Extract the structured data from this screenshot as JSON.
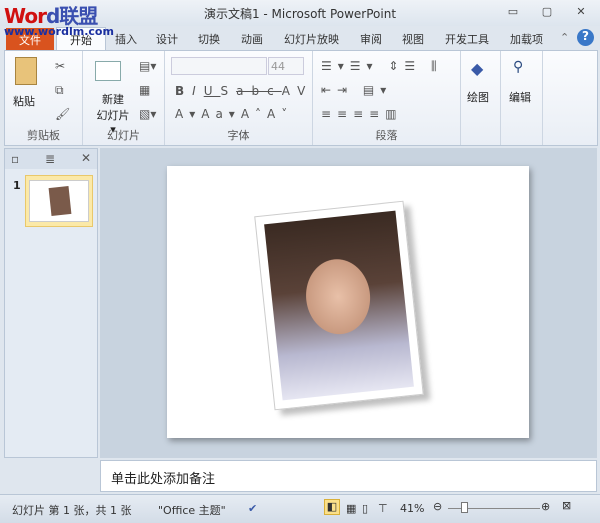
{
  "window": {
    "title": "演示文稿1 - Microsoft PowerPoint",
    "minimize": "▭",
    "maximize": "▢",
    "close": "✕"
  },
  "watermark": {
    "logo_a": "Word",
    "logo_b": "联盟",
    "url": "www.wordlm.com"
  },
  "tabs": [
    {
      "label": "文件"
    },
    {
      "label": "开始"
    },
    {
      "label": "插入"
    },
    {
      "label": "设计"
    },
    {
      "label": "切换"
    },
    {
      "label": "动画"
    },
    {
      "label": "幻灯片放映"
    },
    {
      "label": "审阅"
    },
    {
      "label": "视图"
    },
    {
      "label": "开发工具"
    },
    {
      "label": "加载项"
    }
  ],
  "ribbon": {
    "clipboard": {
      "label": "剪贴板",
      "paste": "粘贴"
    },
    "slides": {
      "label": "幻灯片",
      "new_slide_1": "新建",
      "new_slide_2": "幻灯片 ▾"
    },
    "font": {
      "label": "字体",
      "font_name": "",
      "font_size": "44"
    },
    "paragraph": {
      "label": "段落"
    },
    "drawing": {
      "label": "绘图"
    },
    "editing": {
      "label": "编辑"
    }
  },
  "slide_panel": {
    "slide_number": "1"
  },
  "notes": {
    "placeholder": "单击此处添加备注"
  },
  "status": {
    "slide_info": "幻灯片 第 1 张，共 1 张",
    "theme": "\"Office 主题\"",
    "zoom": "41%",
    "zoom_level_percent": 41
  }
}
